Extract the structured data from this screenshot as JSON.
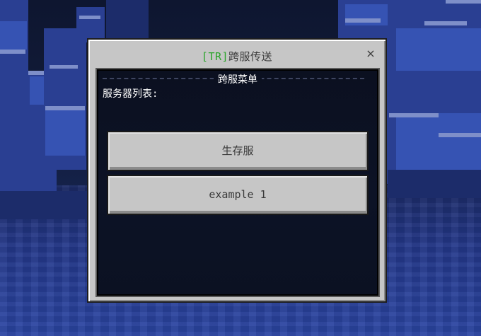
{
  "dialog": {
    "title_tag": "[TR]",
    "title_text": "跨服传送",
    "close_label": "×",
    "header": "跨服菜单",
    "list_label": "服务器列表:",
    "servers": [
      {
        "label": "生存服"
      },
      {
        "label": "example 1"
      }
    ]
  },
  "colors": {
    "tag_green": "#2aa52a",
    "dialog_bg": "#c6c6c6",
    "panel_bg": "#0b1020"
  }
}
